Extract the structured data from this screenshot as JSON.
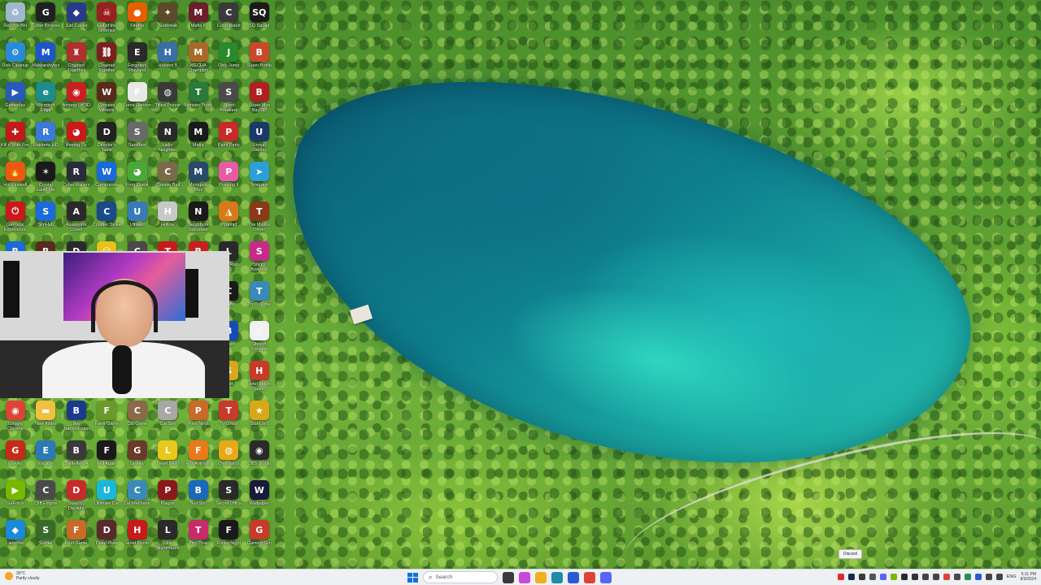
{
  "desktop": {
    "wallpaper": "aerial-lake-forest",
    "icons": [
      {
        "label": "Recycle Bin",
        "icon": "recycle-bin-icon",
        "color": "#9fb8d0",
        "glyph": "♻"
      },
      {
        "label": "Cyber Browse",
        "icon": "g-hub-icon",
        "color": "#202020",
        "glyph": "G"
      },
      {
        "label": "Just Cause",
        "icon": "shield-app-icon",
        "color": "#2a3a8a",
        "glyph": "◆"
      },
      {
        "label": "Fall of the Gnomes",
        "icon": "game-icon",
        "color": "#9a1f1f",
        "glyph": "☠"
      },
      {
        "label": "Firefox",
        "icon": "firefox-icon",
        "color": "#e66000",
        "glyph": "●"
      },
      {
        "label": "Sunbreak",
        "icon": "game-icon",
        "color": "#5c4a2a",
        "glyph": "✦"
      },
      {
        "label": "Mafia II",
        "icon": "game-icon",
        "color": "#6b1f2a",
        "glyph": "M"
      },
      {
        "label": "Contraband",
        "icon": "game-icon",
        "color": "#3a3a3a",
        "glyph": "C"
      },
      {
        "label": "SQ Squad",
        "icon": "game-icon",
        "color": "#1a1a1a",
        "glyph": "SQ"
      },
      {
        "label": "Disk Cleanup",
        "icon": "app-icon",
        "color": "#2b8ad8",
        "glyph": "⚙"
      },
      {
        "label": "Malwarebytes",
        "icon": "malwarebytes-icon",
        "color": "#1e56c9",
        "glyph": "M"
      },
      {
        "label": "Chained Together",
        "icon": "game-icon",
        "color": "#b03030",
        "glyph": "♜"
      },
      {
        "label": "Chained Together",
        "icon": "game-icon",
        "color": "#7a2020",
        "glyph": "⛓"
      },
      {
        "label": "Forgotten Playland",
        "icon": "epic-games-icon",
        "color": "#2a2a2a",
        "glyph": "E"
      },
      {
        "label": "Horizon 5",
        "icon": "game-icon",
        "color": "#3a6ea8",
        "glyph": "H"
      },
      {
        "label": "MECHA Champion",
        "icon": "game-icon",
        "color": "#a86a2a",
        "glyph": "M"
      },
      {
        "label": "Only Jump",
        "icon": "game-icon",
        "color": "#2a8a2a",
        "glyph": "J"
      },
      {
        "label": "Super Bottle",
        "icon": "game-icon",
        "color": "#c84a2a",
        "glyph": "B"
      },
      {
        "label": "Gameplay",
        "icon": "app-icon",
        "color": "#2a5ab8",
        "glyph": "▶"
      },
      {
        "label": "Microsoft Edge",
        "icon": "edge-icon",
        "color": "#1e8c8c",
        "glyph": "e"
      },
      {
        "label": "Among Us 3D",
        "icon": "game-icon",
        "color": "#c82020",
        "glyph": "◉"
      },
      {
        "label": "Crossed Wheels",
        "icon": "game-icon",
        "color": "#5a2a1a",
        "glyph": "W"
      },
      {
        "label": "Forza Horizon",
        "icon": "forza-icon",
        "color": "#e8e8e8",
        "glyph": "F"
      },
      {
        "label": "Tilted Puzzle",
        "icon": "game-icon",
        "color": "#3a3a3a",
        "glyph": "◍"
      },
      {
        "label": "Monster Truck",
        "icon": "game-icon",
        "color": "#2a7a3a",
        "glyph": "T"
      },
      {
        "label": "Silent Breakers",
        "icon": "game-icon",
        "color": "#4a4a4a",
        "glyph": "S"
      },
      {
        "label": "Super Mini Bay 3D",
        "icon": "game-icon",
        "color": "#b02020",
        "glyph": "B"
      },
      {
        "label": "Kill it With Fire",
        "icon": "game-icon",
        "color": "#c01a1a",
        "glyph": "✚"
      },
      {
        "label": "Rainbow HD",
        "icon": "app-icon",
        "color": "#3a7ad8",
        "glyph": "R"
      },
      {
        "label": "Among Us",
        "icon": "among-us-icon",
        "color": "#c81a1a",
        "glyph": "◕"
      },
      {
        "label": "Director's Table",
        "icon": "game-icon",
        "color": "#222222",
        "glyph": "D"
      },
      {
        "label": "Sandbox",
        "icon": "game-icon",
        "color": "#6a6a6a",
        "glyph": "S"
      },
      {
        "label": "Hello Neighbor",
        "icon": "game-icon",
        "color": "#2a2a2a",
        "glyph": "N"
      },
      {
        "label": "Mafia",
        "icon": "game-icon",
        "color": "#1a1a1a",
        "glyph": "M"
      },
      {
        "label": "Paint Party",
        "icon": "game-icon",
        "color": "#c82a2a",
        "glyph": "P"
      },
      {
        "label": "Unreal Overlay",
        "icon": "game-icon",
        "color": "#1a3a6a",
        "glyph": "U"
      },
      {
        "label": "Hot Firewall",
        "icon": "game-icon",
        "color": "#e85a10",
        "glyph": "🔥"
      },
      {
        "label": "Crystal Launcher",
        "icon": "app-icon",
        "color": "#1a1a1a",
        "glyph": "✶"
      },
      {
        "label": "Cyber Racers",
        "icon": "game-icon",
        "color": "#2a2a3a",
        "glyph": "R"
      },
      {
        "label": "Commands",
        "icon": "app-icon",
        "color": "#1a6ad8",
        "glyph": "W"
      },
      {
        "label": "Frog Quest",
        "icon": "game-icon",
        "color": "#4aa83a",
        "glyph": "◕"
      },
      {
        "label": "Cheese Ball",
        "icon": "game-icon",
        "color": "#7a6a4a",
        "glyph": "C"
      },
      {
        "label": "Monopoly Plus",
        "icon": "game-icon",
        "color": "#2a4a6a",
        "glyph": "M"
      },
      {
        "label": "Pushing It",
        "icon": "game-icon",
        "color": "#e85aa8",
        "glyph": "P"
      },
      {
        "label": "Telegram",
        "icon": "telegram-icon",
        "color": "#2aa0d8",
        "glyph": "➤"
      },
      {
        "label": "GeForce Experience",
        "icon": "app-icon",
        "color": "#c81a1a",
        "glyph": "⏻"
      },
      {
        "label": "SimHub",
        "icon": "app-icon",
        "color": "#1a6ad8",
        "glyph": "S"
      },
      {
        "label": "Assassin's Creed",
        "icon": "game-icon",
        "color": "#2a2a2a",
        "glyph": "A"
      },
      {
        "label": "Counter Strike",
        "icon": "game-icon",
        "color": "#1a4a8a",
        "glyph": "C"
      },
      {
        "label": "Ultrakill",
        "icon": "game-icon",
        "color": "#3a7ab8",
        "glyph": "U"
      },
      {
        "label": "Hollow",
        "icon": "game-icon",
        "color": "#c8c8c8",
        "glyph": "H"
      },
      {
        "label": "Neighbors Suburban",
        "icon": "game-icon",
        "color": "#1a1a1a",
        "glyph": "N"
      },
      {
        "label": "Pyramid",
        "icon": "game-icon",
        "color": "#d87a1a",
        "glyph": "◮"
      },
      {
        "label": "The Mound Omen",
        "icon": "game-icon",
        "color": "#8a3a1a",
        "glyph": "T"
      },
      {
        "label": "Rayon",
        "icon": "app-icon",
        "color": "#1a6ad8",
        "glyph": "R"
      },
      {
        "label": "Rust",
        "icon": "game-icon",
        "color": "#5a2a1a",
        "glyph": "R"
      },
      {
        "label": "Dark Tools",
        "icon": "app-icon",
        "color": "#2a2a2a",
        "glyph": "D"
      },
      {
        "label": "Smiley",
        "icon": "game-icon",
        "color": "#e8c01a",
        "glyph": "☺"
      },
      {
        "label": "Crafts",
        "icon": "game-icon",
        "color": "#4a4a4a",
        "glyph": "C"
      },
      {
        "label": "Trainer",
        "icon": "app-icon",
        "color": "#c81a1a",
        "glyph": "T"
      },
      {
        "label": "Raft",
        "icon": "game-icon",
        "color": "#c82020",
        "glyph": "R"
      },
      {
        "label": "Lone Ruin",
        "icon": "game-icon",
        "color": "#2a2a2a",
        "glyph": "L"
      },
      {
        "label": "Sticky Business",
        "icon": "game-icon",
        "color": "#c82a8a",
        "glyph": "S"
      },
      {
        "label": "",
        "icon": "blank-icon",
        "color": "rgba(0,0,0,0)",
        "glyph": ""
      },
      {
        "label": "",
        "icon": "blank-icon",
        "color": "rgba(0,0,0,0)",
        "glyph": ""
      },
      {
        "label": "",
        "icon": "blank-icon",
        "color": "rgba(0,0,0,0)",
        "glyph": ""
      },
      {
        "label": "",
        "icon": "blank-icon",
        "color": "rgba(0,0,0,0)",
        "glyph": ""
      },
      {
        "label": "",
        "icon": "blank-icon",
        "color": "rgba(0,0,0,0)",
        "glyph": ""
      },
      {
        "label": "",
        "icon": "blank-icon",
        "color": "rgba(0,0,0,0)",
        "glyph": ""
      },
      {
        "label": "",
        "icon": "blank-icon",
        "color": "rgba(0,0,0,0)",
        "glyph": ""
      },
      {
        "label": "Crafts",
        "icon": "game-icon",
        "color": "#1a1a1a",
        "glyph": "C"
      },
      {
        "label": "Try To Drive",
        "icon": "game-icon",
        "color": "#3a8ab8",
        "glyph": "T"
      },
      {
        "label": "",
        "icon": "blank-icon",
        "color": "rgba(0,0,0,0)",
        "glyph": ""
      },
      {
        "label": "",
        "icon": "blank-icon",
        "color": "rgba(0,0,0,0)",
        "glyph": ""
      },
      {
        "label": "",
        "icon": "blank-icon",
        "color": "rgba(0,0,0,0)",
        "glyph": ""
      },
      {
        "label": "",
        "icon": "blank-icon",
        "color": "rgba(0,0,0,0)",
        "glyph": ""
      },
      {
        "label": "",
        "icon": "blank-icon",
        "color": "rgba(0,0,0,0)",
        "glyph": ""
      },
      {
        "label": "",
        "icon": "blank-icon",
        "color": "rgba(0,0,0,0)",
        "glyph": ""
      },
      {
        "label": "",
        "icon": "blank-icon",
        "color": "rgba(0,0,0,0)",
        "glyph": ""
      },
      {
        "label": "Board",
        "icon": "game-icon",
        "color": "#1a4ab8",
        "glyph": "B"
      },
      {
        "label": "Ubisoft Connect",
        "icon": "ubisoft-icon",
        "color": "#f0f0f0",
        "glyph": "◎"
      },
      {
        "label": "",
        "icon": "blank-icon",
        "color": "rgba(0,0,0,0)",
        "glyph": ""
      },
      {
        "label": "",
        "icon": "blank-icon",
        "color": "rgba(0,0,0,0)",
        "glyph": ""
      },
      {
        "label": "",
        "icon": "blank-icon",
        "color": "rgba(0,0,0,0)",
        "glyph": ""
      },
      {
        "label": "",
        "icon": "blank-icon",
        "color": "rgba(0,0,0,0)",
        "glyph": ""
      },
      {
        "label": "",
        "icon": "blank-icon",
        "color": "rgba(0,0,0,0)",
        "glyph": ""
      },
      {
        "label": "",
        "icon": "blank-icon",
        "color": "rgba(0,0,0,0)",
        "glyph": ""
      },
      {
        "label": "",
        "icon": "blank-icon",
        "color": "rgba(0,0,0,0)",
        "glyph": ""
      },
      {
        "label": "Sort",
        "icon": "game-icon",
        "color": "#d8a81a",
        "glyph": "S"
      },
      {
        "label": "Hotel Lobby Game",
        "icon": "game-icon",
        "color": "#c83a2a",
        "glyph": "H"
      },
      {
        "label": "Google Chrome",
        "icon": "chrome-icon",
        "color": "#db4437",
        "glyph": "◉"
      },
      {
        "label": "New folder",
        "icon": "folder-icon",
        "color": "#f0c040",
        "glyph": "▬"
      },
      {
        "label": "Bet Transmission",
        "icon": "app-icon",
        "color": "#1a3a8a",
        "glyph": "B"
      },
      {
        "label": "Farm Game",
        "icon": "game-icon",
        "color": "#6a9a2a",
        "glyph": "F"
      },
      {
        "label": "Cat Game",
        "icon": "game-icon",
        "color": "#8a6a4a",
        "glyph": "C"
      },
      {
        "label": "Cat Sim",
        "icon": "game-icon",
        "color": "#a8a8a8",
        "glyph": "C"
      },
      {
        "label": "Pixel Ninja",
        "icon": "game-icon",
        "color": "#c86a2a",
        "glyph": "P"
      },
      {
        "label": "TV Ghost",
        "icon": "game-icon",
        "color": "#c83a2a",
        "glyph": "T"
      },
      {
        "label": "Star Lord",
        "icon": "game-icon",
        "color": "#d8a81a",
        "glyph": "★"
      },
      {
        "label": "Gravity",
        "icon": "game-icon",
        "color": "#c82a1a",
        "glyph": "G"
      },
      {
        "label": "Escape",
        "icon": "game-icon",
        "color": "#2a7ab8",
        "glyph": "E"
      },
      {
        "label": "Battlefield 4",
        "icon": "game-icon",
        "color": "#3a3a3a",
        "glyph": "B"
      },
      {
        "label": "Fall Again",
        "icon": "game-icon",
        "color": "#1a1a1a",
        "glyph": "F"
      },
      {
        "label": "Granny",
        "icon": "game-icon",
        "color": "#6a3a2a",
        "glyph": "G"
      },
      {
        "label": "Level Devil",
        "icon": "game-icon",
        "color": "#e8c81a",
        "glyph": "L"
      },
      {
        "label": "Fox Animals",
        "icon": "game-icon",
        "color": "#e87a1a",
        "glyph": "F"
      },
      {
        "label": "Overwatch",
        "icon": "game-icon",
        "color": "#e8a81a",
        "glyph": "◍"
      },
      {
        "label": "OBS Studio",
        "icon": "obs-icon",
        "color": "#2a2a2a",
        "glyph": "◉"
      },
      {
        "label": "GeForce",
        "icon": "nvidia-icon",
        "color": "#76b900",
        "glyph": "▶"
      },
      {
        "label": "Cliff Empire",
        "icon": "game-icon",
        "color": "#4a4a4a",
        "glyph": "C"
      },
      {
        "label": "Dead by Daylight",
        "icon": "game-icon",
        "color": "#c82a2a",
        "glyph": "D"
      },
      {
        "label": "Ultimate Car",
        "icon": "game-icon",
        "color": "#1ab8d8",
        "glyph": "U"
      },
      {
        "label": "Car Mechanic",
        "icon": "game-icon",
        "color": "#3a8ab8",
        "glyph": "C"
      },
      {
        "label": "Plague",
        "icon": "game-icon",
        "color": "#8a1a1a",
        "glyph": "P"
      },
      {
        "label": "Bus Sim",
        "icon": "game-icon",
        "color": "#1a6ab8",
        "glyph": "B"
      },
      {
        "label": "Secret Office",
        "icon": "game-icon",
        "color": "#2a2a2a",
        "glyph": "S"
      },
      {
        "label": "Wallpaper",
        "icon": "game-icon",
        "color": "#1a1a3a",
        "glyph": "W"
      },
      {
        "label": "Launcher",
        "icon": "app-icon",
        "color": "#1a8ad8",
        "glyph": "◆"
      },
      {
        "label": "Soldier",
        "icon": "game-icon",
        "color": "#3a6a2a",
        "glyph": "S"
      },
      {
        "label": "Fruit Game",
        "icon": "game-icon",
        "color": "#c86a2a",
        "glyph": "F"
      },
      {
        "label": "Dead Plate",
        "icon": "game-icon",
        "color": "#5a2a2a",
        "glyph": "D"
      },
      {
        "label": "Hotel Doom",
        "icon": "game-icon",
        "color": "#c81a1a",
        "glyph": "H"
      },
      {
        "label": "Little Nightmares",
        "icon": "game-icon",
        "color": "#2a2a2a",
        "glyph": "L"
      },
      {
        "label": "Tiny Tina",
        "icon": "game-icon",
        "color": "#c82a6a",
        "glyph": "T"
      },
      {
        "label": "Friday Night",
        "icon": "game-icon",
        "color": "#1a1a1a",
        "glyph": "F"
      },
      {
        "label": "Gaming Sim",
        "icon": "game-icon",
        "color": "#c83a2a",
        "glyph": "G"
      }
    ]
  },
  "tooltip": {
    "text": "Discord"
  },
  "taskbar": {
    "weather": {
      "temp": "30°C",
      "desc": "Partly cloudy"
    },
    "search_placeholder": "Search",
    "pinned": [
      {
        "name": "file-explorer-icon",
        "color": "#3a3a3a"
      },
      {
        "name": "copilot-icon",
        "color": "#c84ad8"
      },
      {
        "name": "folder-icon",
        "color": "#f0b020"
      },
      {
        "name": "edge-icon",
        "color": "#1e8ca8"
      },
      {
        "name": "store-icon",
        "color": "#2a5ad8"
      },
      {
        "name": "chrome-icon",
        "color": "#db4437"
      },
      {
        "name": "discord-icon",
        "color": "#5865f2"
      }
    ],
    "tray": {
      "icons": [
        {
          "name": "opera-icon",
          "color": "#e02a2a"
        },
        {
          "name": "steam-tray-icon",
          "color": "#1a2a4a"
        },
        {
          "name": "app-tray-icon",
          "color": "#3a3a3a"
        },
        {
          "name": "app-tray-icon",
          "color": "#555555"
        },
        {
          "name": "discord-tray-icon",
          "color": "#5865f2"
        },
        {
          "name": "nvidia-tray-icon",
          "color": "#76b900"
        },
        {
          "name": "app-tray-icon",
          "color": "#2a2a2a"
        },
        {
          "name": "app-tray-icon",
          "color": "#333333"
        },
        {
          "name": "wifi-icon",
          "color": "#444444"
        },
        {
          "name": "chevron-up-icon",
          "color": "#444444"
        },
        {
          "name": "chrome-tray-icon",
          "color": "#db4437"
        },
        {
          "name": "app-tray-icon",
          "color": "#4a4a4a"
        },
        {
          "name": "app-tray-icon",
          "color": "#2a8a5a"
        },
        {
          "name": "bluetooth-icon",
          "color": "#2a5ad8"
        },
        {
          "name": "network-icon",
          "color": "#444444"
        },
        {
          "name": "volume-icon",
          "color": "#444444"
        }
      ],
      "language": "ENG",
      "time": "5:11 PM",
      "date": "8/9/2024"
    }
  }
}
